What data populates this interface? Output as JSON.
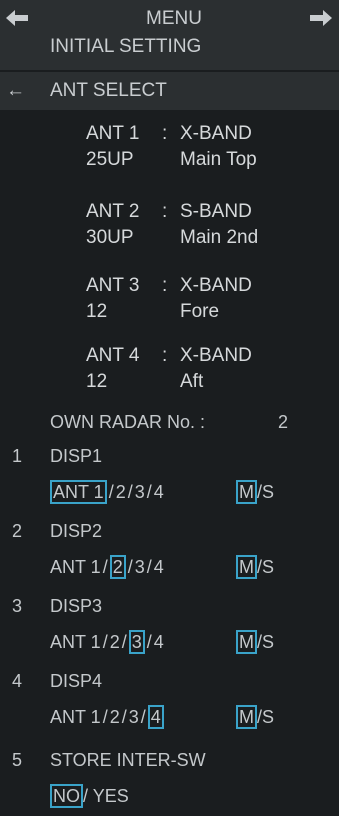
{
  "header": {
    "left_arrow": "left-arrow-icon",
    "title": "MENU",
    "right_arrow": "right-arrow-icon"
  },
  "breadcrumb": {
    "parent": "INITIAL SETTING",
    "back_arrow": "←",
    "current": "ANT SELECT"
  },
  "antennas": [
    {
      "name": "ANT 1",
      "sep": ":",
      "band": "X-BAND",
      "model": "25UP",
      "location": "Main Top"
    },
    {
      "name": "ANT 2",
      "sep": ":",
      "band": "S-BAND",
      "model": "30UP",
      "location": "Main 2nd"
    },
    {
      "name": "ANT 3",
      "sep": ":",
      "band": "X-BAND",
      "model": "12",
      "location": "Fore"
    },
    {
      "name": "ANT 4",
      "sep": ":",
      "band": "X-BAND",
      "model": "12",
      "location": "Aft"
    }
  ],
  "own_radar": {
    "label": "OWN RADAR No. :",
    "value": "2"
  },
  "displays": [
    {
      "num": "1",
      "name": "DISP1",
      "ant_prefix": "ANT ",
      "opts": [
        "1",
        "2",
        "3",
        "4"
      ],
      "selected_ant": 0,
      "ms": [
        "M",
        "S"
      ],
      "selected_ms": 0
    },
    {
      "num": "2",
      "name": "DISP2",
      "ant_prefix": "ANT ",
      "opts": [
        "1",
        "2",
        "3",
        "4"
      ],
      "selected_ant": 1,
      "ms": [
        "M",
        "S"
      ],
      "selected_ms": 0
    },
    {
      "num": "3",
      "name": "DISP3",
      "ant_prefix": "ANT ",
      "opts": [
        "1",
        "2",
        "3",
        "4"
      ],
      "selected_ant": 2,
      "ms": [
        "M",
        "S"
      ],
      "selected_ms": 0
    },
    {
      "num": "4",
      "name": "DISP4",
      "ant_prefix": "ANT ",
      "opts": [
        "1",
        "2",
        "3",
        "4"
      ],
      "selected_ant": 3,
      "ms": [
        "M",
        "S"
      ],
      "selected_ms": 0
    }
  ],
  "store": {
    "num": "5",
    "label": "STORE INTER-SW",
    "no": "NO",
    "sep": "/ ",
    "yes": "YES"
  },
  "colors": {
    "accent": "#3aa3c9",
    "background": "#1a1d1f",
    "band": "#2b2f31"
  }
}
